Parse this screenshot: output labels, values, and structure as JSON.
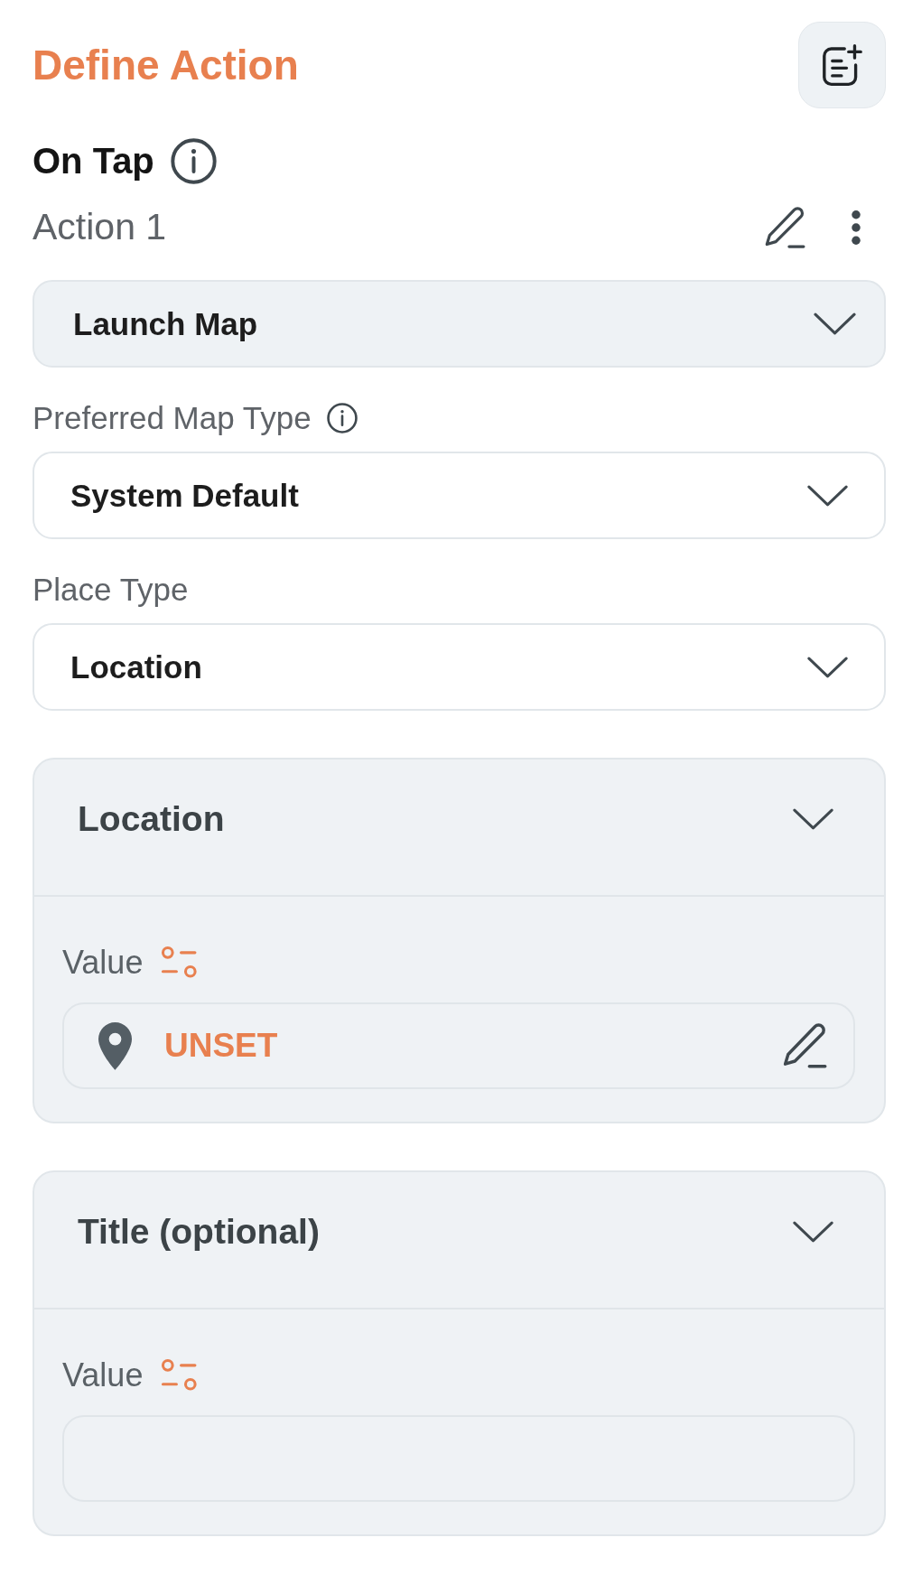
{
  "panel": {
    "title": "Define Action"
  },
  "trigger": {
    "label": "On Tap"
  },
  "action": {
    "name": "Action 1"
  },
  "action_type": {
    "value": "Launch Map"
  },
  "fields": [
    {
      "label": "Preferred Map Type",
      "info": true,
      "value": "System Default"
    },
    {
      "label": "Place Type",
      "info": false,
      "value": "Location"
    }
  ],
  "sections": [
    {
      "kind": "location",
      "title": "Location",
      "expanded": true,
      "value_label": "Value",
      "value": "UNSET"
    },
    {
      "kind": "text",
      "title": "Title (optional)",
      "expanded": true,
      "value_label": "Value"
    }
  ]
}
